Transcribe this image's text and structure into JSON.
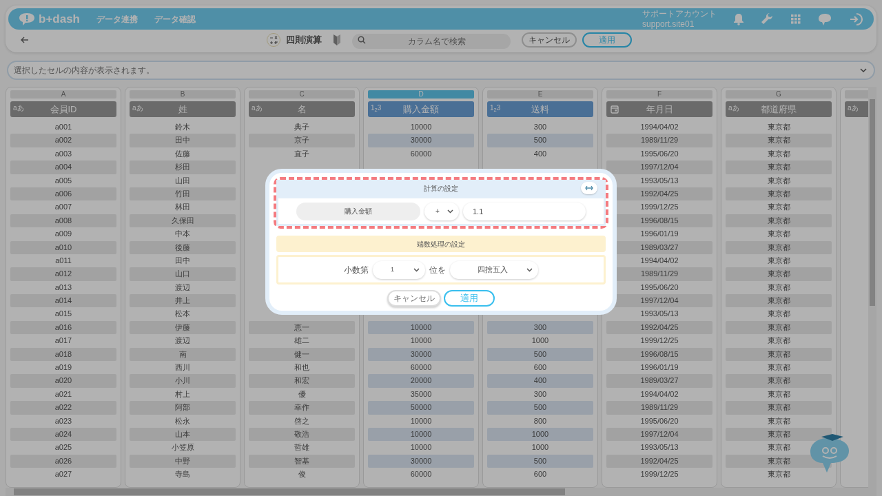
{
  "header": {
    "logo": "b+dash",
    "nav": [
      {
        "label": "データ連携"
      },
      {
        "label": "データ確認"
      }
    ],
    "account": {
      "label": "サポートアカウント",
      "id": "support.site01"
    }
  },
  "toolbar": {
    "title": "四則演算",
    "search": {
      "placeholder": "カラム名で検索"
    },
    "buttons": [
      {
        "label": "キャンセル",
        "kind": "secondary"
      },
      {
        "label": "適用",
        "kind": "primary"
      }
    ]
  },
  "info_bar": {
    "placeholder": "選択したセルの内容が表示されます。"
  },
  "table": {
    "columns": [
      {
        "letter": "A",
        "name": "会員ID",
        "kind": "text",
        "type_label": "aあ",
        "selected": false,
        "cells": [
          "a001",
          "a002",
          "a003",
          "a004",
          "a005",
          "a006",
          "a007",
          "a008",
          "a009",
          "a010",
          "a011",
          "a012",
          "a013",
          "a014",
          "a015",
          "a016",
          "a017",
          "a018",
          "a019",
          "a020",
          "a021",
          "a022",
          "a023",
          "a024",
          "a025",
          "a026",
          "a027"
        ]
      },
      {
        "letter": "B",
        "name": "姓",
        "kind": "text",
        "type_label": "aあ",
        "selected": false,
        "cells": [
          "鈴木",
          "田中",
          "佐藤",
          "杉田",
          "山田",
          "竹田",
          "林田",
          "久保田",
          "中本",
          "後藤",
          "田中",
          "山口",
          "渡辺",
          "井上",
          "松本",
          "伊藤",
          "渡辺",
          "南",
          "西川",
          "小川",
          "村上",
          "阿部",
          "松永",
          "山本",
          "小笠原",
          "中野",
          "寺島"
        ]
      },
      {
        "letter": "C",
        "name": "名",
        "kind": "text",
        "type_label": "aあ",
        "selected": false,
        "cells": [
          "典子",
          "京子",
          "直子",
          null,
          null,
          null,
          null,
          null,
          null,
          null,
          null,
          null,
          null,
          null,
          null,
          "恵一",
          "雄二",
          "健一",
          "和也",
          "和宏",
          "優",
          "幸作",
          "啓之",
          "敬浩",
          "哲雄",
          "智基",
          "俊"
        ]
      },
      {
        "letter": "D",
        "name": "購入金額",
        "kind": "number",
        "type_label": "1$_{2}$3",
        "selected": true,
        "cells": [
          "10000",
          "30000",
          "60000",
          null,
          null,
          null,
          null,
          null,
          null,
          null,
          null,
          null,
          null,
          null,
          null,
          "10000",
          "10000",
          "30000",
          "60000",
          "20000",
          "35000",
          "50000",
          "10000",
          "10000",
          "10000",
          "30000",
          "60000"
        ]
      },
      {
        "letter": "E",
        "name": "送料",
        "kind": "number",
        "type_label": "1$_{2}$3",
        "selected": false,
        "cells": [
          "300",
          "500",
          "400",
          null,
          null,
          null,
          null,
          null,
          null,
          null,
          null,
          null,
          null,
          null,
          null,
          "300",
          "1000",
          "500",
          "600",
          "400",
          "300",
          "500",
          "800",
          "1000",
          "1000",
          "500",
          "600"
        ]
      },
      {
        "letter": "F",
        "name": "年月日",
        "kind": "date",
        "selected": false,
        "cells": [
          "1994/04/02",
          "1989/11/29",
          "1995/06/20",
          "1997/12/04",
          "1993/05/13",
          "1992/04/25",
          "1999/12/25",
          "1996/08/15",
          "1996/01/19",
          "1989/03/27",
          "1994/04/02",
          "1989/11/29",
          "1995/06/20",
          "1997/12/04",
          "1993/05/13",
          "1992/04/25",
          "1999/12/25",
          "1996/08/15",
          "1996/01/19",
          "1989/03/27",
          "1994/04/02",
          "1989/11/29",
          "1995/06/20",
          "1997/12/04",
          "1993/05/13",
          "1992/04/25",
          "1999/12/25"
        ]
      },
      {
        "letter": "G",
        "name": "都道府県",
        "kind": "text",
        "type_label": "aあ",
        "selected": false,
        "cells": [
          "東京都",
          "東京都",
          "東京都",
          "東京都",
          "東京都",
          "東京都",
          "東京都",
          "東京都",
          "東京都",
          "東京都",
          "東京都",
          "東京都",
          "東京都",
          "東京都",
          "東京都",
          "東京都",
          "東京都",
          "東京都",
          "東京都",
          "東京都",
          "東京都",
          "東京都",
          "東京都",
          "東京都",
          "東京都",
          "東京都",
          "東京都"
        ]
      },
      {
        "kind": "text",
        "type_label": "aあ",
        "selected": false
      }
    ]
  },
  "dialog": {
    "calc_title": "計算の設定",
    "column": "購入金額",
    "operator": "+",
    "operand": "1.1",
    "rounding_title": "端数処理の設定",
    "decimal_prefix": "小数第",
    "decimal_place": "1",
    "decimal_suffix": "位を",
    "rounding_mode": "四捨五入",
    "buttons": [
      {
        "label": "キャンセル",
        "kind": "secondary"
      },
      {
        "label": "適用",
        "kind": "primary"
      }
    ]
  }
}
